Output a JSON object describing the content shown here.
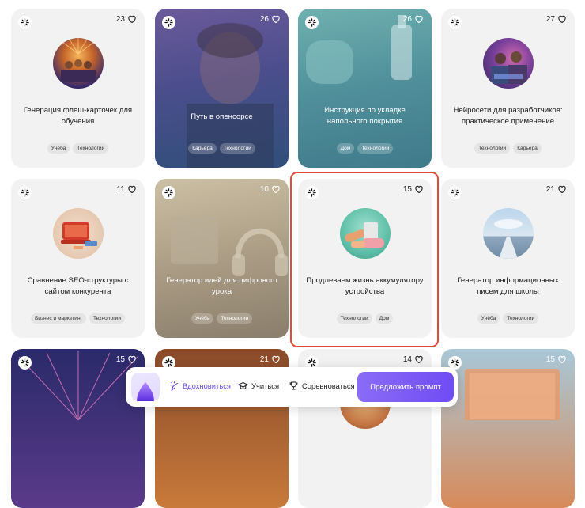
{
  "cards": [
    {
      "title": "Генерация флеш-карточек для обучения",
      "likes": "23",
      "tags": [
        "Учёба",
        "Технологии"
      ],
      "icon": "spark-icon"
    },
    {
      "title": "Путь в опенсорсе",
      "likes": "26",
      "tags": [
        "Карьера",
        "Технологии"
      ],
      "icon": "spark-icon"
    },
    {
      "title": "Инструкция по укладке напольного покрытия",
      "likes": "26",
      "tags": [
        "Дом",
        "Технологии"
      ],
      "icon": "spark-icon"
    },
    {
      "title": "Нейросети для разработчиков: практическое применение",
      "likes": "27",
      "tags": [
        "Технологии",
        "Карьера"
      ],
      "icon": "spark-icon"
    },
    {
      "title": "Сравнение SEO-структуры с сайтом конкурента",
      "likes": "11",
      "tags": [
        "Бизнес и маркетинг",
        "Технологии"
      ],
      "icon": "spark-icon"
    },
    {
      "title": "Генератор идей для цифрового урока",
      "likes": "10",
      "tags": [
        "Учёба",
        "Технологии"
      ],
      "icon": "spark-icon"
    },
    {
      "title": "Продлеваем жизнь аккумулятору устройства",
      "likes": "15",
      "tags": [
        "Технологии",
        "Дом"
      ],
      "icon": "spark-icon"
    },
    {
      "title": "Генератор информационных писем для школы",
      "likes": "21",
      "tags": [
        "Учёба",
        "Технологии"
      ],
      "icon": "spark-icon"
    },
    {
      "title": "",
      "likes": "15",
      "tags": [],
      "icon": "spark-icon"
    },
    {
      "title": "",
      "likes": "21",
      "tags": [],
      "icon": "spark-icon"
    },
    {
      "title": "",
      "likes": "14",
      "tags": [],
      "icon": "spark-icon"
    },
    {
      "title": "",
      "likes": "15",
      "tags": [],
      "icon": "spark-icon"
    }
  ],
  "bottom_bar": {
    "nav": [
      {
        "label": "Вдохновиться",
        "icon": "inspire-icon",
        "active": true
      },
      {
        "label": "Учиться",
        "icon": "graduation-cap-icon",
        "active": false
      },
      {
        "label": "Соревноваться",
        "icon": "trophy-icon",
        "active": false
      }
    ],
    "cta_label": "Предложить промпт"
  },
  "colors": {
    "accent": "#6f4cf3",
    "highlight_border": "#e04a36",
    "card_bg": "#f2f2f2"
  }
}
